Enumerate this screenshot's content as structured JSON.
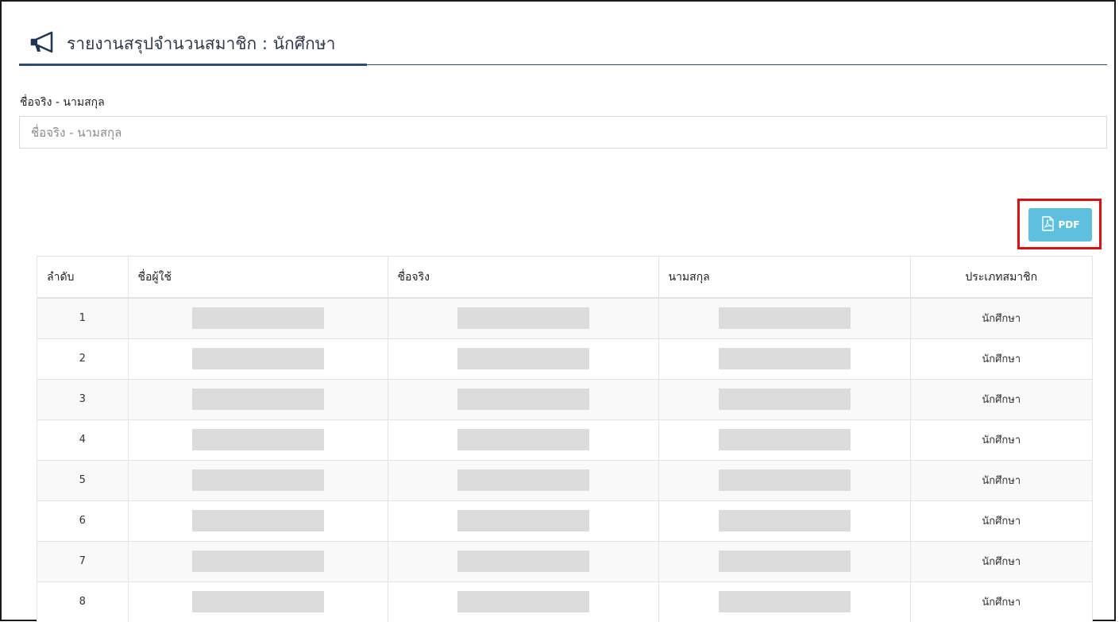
{
  "header": {
    "title": "รายงานสรุปจำนวนสมาชิก : นักศึกษา",
    "icon": "megaphone-icon"
  },
  "search": {
    "label": "ชื่อจริง - นามสกุล",
    "placeholder": "ชื่อจริง - นามสกุล",
    "value": ""
  },
  "toolbar": {
    "pdf_label": "PDF",
    "pdf_icon": "pdf-file-icon"
  },
  "colors": {
    "header_accent": "#2e4d73",
    "pdf_button": "#5ec0de",
    "highlight": "#e01010"
  },
  "table": {
    "columns": [
      "ลำดับ",
      "ชื่อผู้ใช้",
      "ชื่อจริง",
      "นามสกุล",
      "ประเภทสมาชิก"
    ],
    "rows": [
      {
        "no": "1",
        "type": "นักศึกษา"
      },
      {
        "no": "2",
        "type": "นักศึกษา"
      },
      {
        "no": "3",
        "type": "นักศึกษา"
      },
      {
        "no": "4",
        "type": "นักศึกษา"
      },
      {
        "no": "5",
        "type": "นักศึกษา"
      },
      {
        "no": "6",
        "type": "นักศึกษา"
      },
      {
        "no": "7",
        "type": "นักศึกษา"
      },
      {
        "no": "8",
        "type": "นักศึกษา"
      }
    ]
  }
}
